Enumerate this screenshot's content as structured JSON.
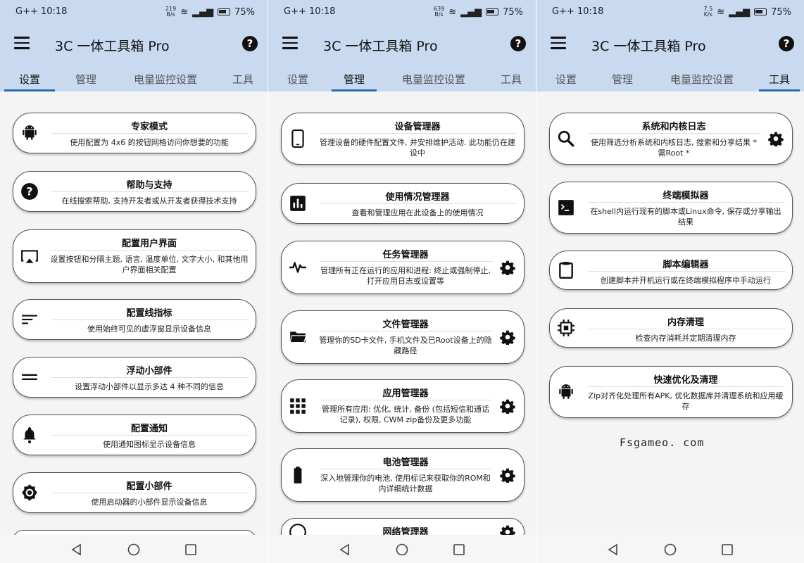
{
  "status": [
    {
      "time": "G++ 10:18",
      "speed_num": "219",
      "speed_unit": "B/s",
      "battery": "75%"
    },
    {
      "time": "G++ 10:18",
      "speed_num": "639",
      "speed_unit": "B/s",
      "battery": "75%"
    },
    {
      "time": "G++ 10:18",
      "speed_num": "7.5",
      "speed_unit": "K/s",
      "battery": "75%"
    }
  ],
  "app": {
    "title": "3C 一体工具箱 Pro",
    "help_icon": "?"
  },
  "tabs": [
    "设置",
    "管理",
    "电量监控设置",
    "工具"
  ],
  "screens": [
    {
      "active_tab": 0,
      "items": [
        {
          "title": "专家模式",
          "desc": "使用配置为 4x6 的按钮网格访问你想要的功能",
          "icon": "android-icon"
        },
        {
          "title": "帮助与支持",
          "desc": "在线搜索帮助, 支持开发者或从开发者获得技术支持",
          "icon": "help-circle-icon"
        },
        {
          "title": "配置用户界面",
          "desc": "设置按钮和分隔主题, 语言, 温度单位, 文字大小, 和其他用户界面相关配置",
          "icon": "cast-screen-icon"
        },
        {
          "title": "配置线指标",
          "desc": "使用始终可见的虚浮窗显示设备信息",
          "icon": "lines-icon"
        },
        {
          "title": "浮动小部件",
          "desc": "设置浮动小部件以显示多达 4 种不同的信息",
          "icon": "equal-lines-icon"
        },
        {
          "title": "配置通知",
          "desc": "使用通知图标显示设备信息",
          "icon": "bell-icon"
        },
        {
          "title": "配置小部件",
          "desc": "使用启动器的小部件显示设备信息",
          "icon": "gear-widget-icon"
        }
      ]
    },
    {
      "active_tab": 1,
      "items": [
        {
          "title": "设备管理器",
          "desc": "管理设备的硬件配置文件, 并安排维护活动. 此功能仍在建设中",
          "icon": "phone-icon",
          "gear": false
        },
        {
          "title": "使用情况管理器",
          "desc": "查看和管理应用在此设备上的使用情况",
          "icon": "bar-chart-icon",
          "gear": false
        },
        {
          "title": "任务管理器",
          "desc": "管理所有正在运行的应用和进程: 终止或强制停止, 打开应用日志或设置等",
          "icon": "pulse-icon",
          "gear": true
        },
        {
          "title": "文件管理器",
          "desc": "管理你的SD卡文件, 手机文件及已Root设备上的隐藏路径",
          "icon": "folder-icon",
          "gear": true
        },
        {
          "title": "应用管理器",
          "desc": "管理所有应用: 优化, 统计, 备份 (包括短信和通话记录), 权限, CWM zip备份及更多功能",
          "icon": "grid-icon",
          "gear": true
        },
        {
          "title": "电池管理器",
          "desc": "深入地管理你的电池, 使用标记来获取你的ROM和内详细统计数据",
          "icon": "battery-icon",
          "gear": true
        },
        {
          "title": "网络管理器",
          "desc": "",
          "icon": "network-icon",
          "gear": true
        }
      ]
    },
    {
      "active_tab": 3,
      "items": [
        {
          "title": "系统和内核日志",
          "desc": "使用筛选分析系统和内核日志, 搜索和分享结果 * 需Root *",
          "icon": "search-icon",
          "gear": true
        },
        {
          "title": "终端模拟器",
          "desc": "在shell内运行现有的脚本或Linux命令, 保存或分享输出结果",
          "icon": "terminal-icon",
          "gear": false
        },
        {
          "title": "脚本编辑器",
          "desc": "创建脚本并开机运行或在终端模拟程序中手动运行",
          "icon": "clipboard-icon",
          "gear": false
        },
        {
          "title": "内存清理",
          "desc": "检查内存消耗并定期清理内存",
          "icon": "chip-icon",
          "gear": false
        },
        {
          "title": "快速优化及清理",
          "desc": "Zip对齐化处理所有APK, 优化数据库并清理系统和应用缓存",
          "icon": "android-icon",
          "gear": false
        }
      ]
    }
  ],
  "watermark": "Fsgameo. com"
}
